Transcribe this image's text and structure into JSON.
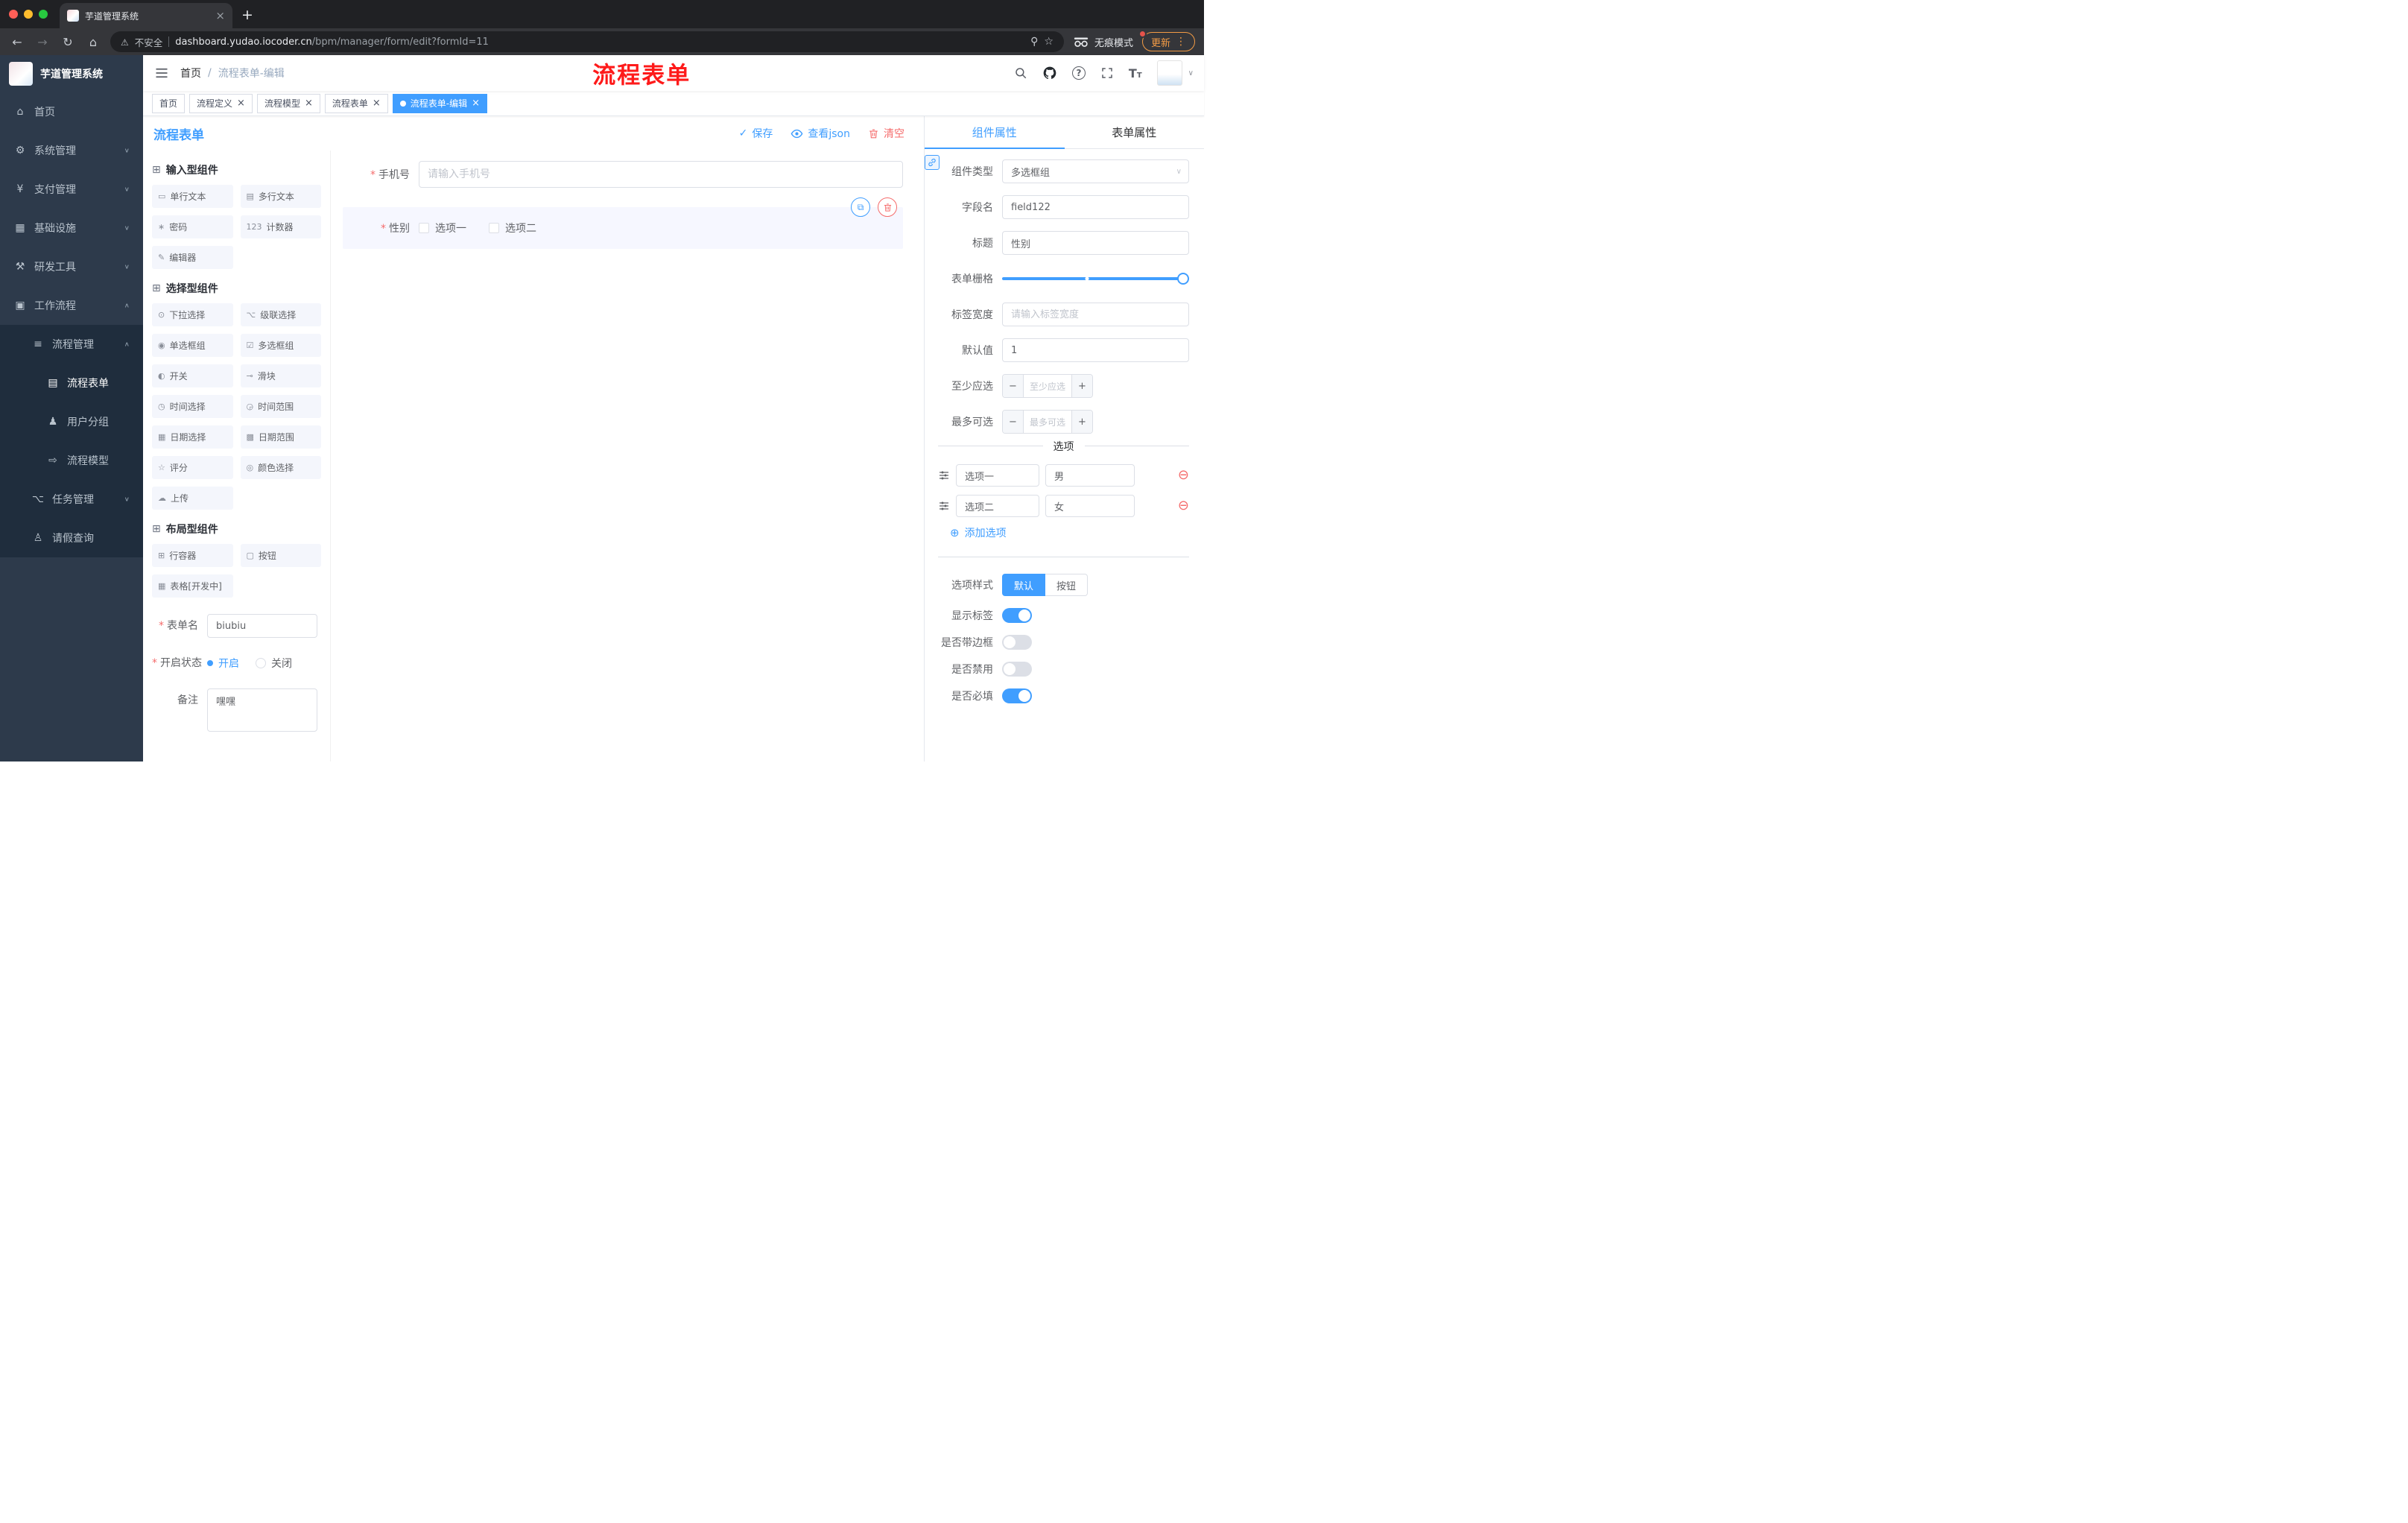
{
  "colors": {
    "accent": "#409eff",
    "danger": "#f56c6c",
    "annotation_red": "#fe1a1a",
    "sidebar_bg": "#2d3a4b"
  },
  "browser": {
    "tab_title": "芋道管理系统",
    "security_label": "不安全",
    "url_domain": "dashboard.yudao.iocoder.cn",
    "url_path": "/bpm/manager/form/edit?formId=11",
    "incognito_label": "无痕模式",
    "update_label": "更新"
  },
  "sidebar": {
    "logo_title": "芋道管理系统",
    "items": [
      {
        "label": "首页",
        "icon": "⌂",
        "icon_name": "home-icon"
      },
      {
        "label": "系统管理",
        "icon": "⚙",
        "icon_name": "gear-icon",
        "chevron": "∨"
      },
      {
        "label": "支付管理",
        "icon": "¥",
        "icon_name": "yen-icon",
        "chevron": "∨"
      },
      {
        "label": "基础设施",
        "icon": "▦",
        "icon_name": "infrastructure-icon",
        "chevron": "∨"
      },
      {
        "label": "研发工具",
        "icon": "⚒",
        "icon_name": "dev-tools-icon",
        "chevron": "∨"
      },
      {
        "label": "工作流程",
        "icon": "▣",
        "icon_name": "workflow-icon",
        "chevron": "∧",
        "open": true
      },
      {
        "label": "流程管理",
        "icon": "≡",
        "icon_name": "process-list-icon",
        "chevron": "∧",
        "l1": true,
        "open": true
      },
      {
        "label": "流程表单",
        "icon": "▤",
        "icon_name": "form-document-icon",
        "l2": true,
        "active": true
      },
      {
        "label": "用户分组",
        "icon": "♟",
        "icon_name": "user-group-icon",
        "l2": true
      },
      {
        "label": "流程模型",
        "icon": "⇨",
        "icon_name": "send-icon",
        "l2": true
      },
      {
        "label": "任务管理",
        "icon": "⌥",
        "icon_name": "task-tree-icon",
        "chevron": "∨",
        "l1": true
      },
      {
        "label": "请假查询",
        "icon": "♙",
        "icon_name": "person-icon",
        "l1": true
      }
    ]
  },
  "header": {
    "breadcrumb_home": "首页",
    "breadcrumb_current": "流程表单-编辑",
    "annotation": "流程表单"
  },
  "tags": [
    {
      "label": "首页"
    },
    {
      "label": "流程定义",
      "closable": true
    },
    {
      "label": "流程模型",
      "closable": true
    },
    {
      "label": "流程表单",
      "closable": true
    },
    {
      "label": "流程表单-编辑",
      "closable": true,
      "active": true
    }
  ],
  "workbar": {
    "title": "流程表单",
    "save": "保存",
    "view_json": "查看json",
    "clear": "清空"
  },
  "palette": {
    "sections": {
      "input": {
        "title": "输入型组件",
        "items": [
          {
            "label": "单行文本",
            "icon": "▭",
            "icon_name": "text-field-icon"
          },
          {
            "label": "多行文本",
            "icon": "▤",
            "icon_name": "textarea-icon"
          },
          {
            "label": "密码",
            "icon": "∗",
            "icon_name": "lock-icon"
          },
          {
            "label": "计数器",
            "icon": "123",
            "icon_name": "counter-icon"
          },
          {
            "label": "编辑器",
            "icon": "✎",
            "icon_name": "editor-icon"
          }
        ]
      },
      "select": {
        "title": "选择型组件",
        "items": [
          {
            "label": "下拉选择",
            "icon": "⊙",
            "icon_name": "dropdown-icon"
          },
          {
            "label": "级联选择",
            "icon": "⌥",
            "icon_name": "cascade-icon"
          },
          {
            "label": "单选框组",
            "icon": "◉",
            "icon_name": "radio-group-icon"
          },
          {
            "label": "多选框组",
            "icon": "☑",
            "icon_name": "checkbox-group-icon"
          },
          {
            "label": "开关",
            "icon": "◐",
            "icon_name": "switch-icon"
          },
          {
            "label": "滑块",
            "icon": "⊸",
            "icon_name": "slider-icon"
          },
          {
            "label": "时间选择",
            "icon": "◷",
            "icon_name": "time-picker-icon"
          },
          {
            "label": "时间范围",
            "icon": "◶",
            "icon_name": "time-range-icon"
          },
          {
            "label": "日期选择",
            "icon": "▦",
            "icon_name": "date-picker-icon"
          },
          {
            "label": "日期范围",
            "icon": "▩",
            "icon_name": "date-range-icon"
          },
          {
            "label": "评分",
            "icon": "☆",
            "icon_name": "rate-star-icon"
          },
          {
            "label": "颜色选择",
            "icon": "◎",
            "icon_name": "color-picker-icon"
          },
          {
            "label": "上传",
            "icon": "☁",
            "icon_name": "upload-icon"
          }
        ]
      },
      "layout": {
        "title": "布局型组件",
        "items": [
          {
            "label": "行容器",
            "icon": "⊞",
            "icon_name": "row-container-icon"
          },
          {
            "label": "按钮",
            "icon": "▢",
            "icon_name": "button-icon"
          },
          {
            "label": "表格[开发中]",
            "icon": "▦",
            "icon_name": "table-icon"
          }
        ]
      }
    },
    "form": {
      "name_label": "表单名",
      "name_value": "biubiu",
      "status_label": "开启状态",
      "status_on": "开启",
      "status_off": "关闭",
      "remark_label": "备注",
      "remark_value": "嘿嘿"
    }
  },
  "canvas": {
    "phone_label": "手机号",
    "phone_placeholder": "请输入手机号",
    "gender_label": "性别",
    "gender_options": [
      "选项一",
      "选项二"
    ]
  },
  "props": {
    "tab_component": "组件属性",
    "tab_form": "表单属性",
    "type_label": "组件类型",
    "type_value": "多选框组",
    "field_label": "字段名",
    "field_value": "field122",
    "title_label": "标题",
    "title_value": "性别",
    "grid_label": "表单栅格",
    "labelwidth_label": "标签宽度",
    "labelwidth_placeholder": "请输入标签宽度",
    "default_label": "默认值",
    "default_value": "1",
    "min_label": "至少应选",
    "min_placeholder": "至少应选",
    "max_label": "最多可选",
    "max_placeholder": "最多可选",
    "options_divider": "选项",
    "options": [
      {
        "label": "选项一",
        "value": "男"
      },
      {
        "label": "选项二",
        "value": "女"
      }
    ],
    "add_option": "添加选项",
    "style_label": "选项样式",
    "style_default": "默认",
    "style_button": "按钮",
    "toggles": [
      {
        "label": "显示标签",
        "on": true
      },
      {
        "label": "是否带边框",
        "on": false
      },
      {
        "label": "是否禁用",
        "on": false
      },
      {
        "label": "是否必填",
        "on": true
      }
    ]
  }
}
